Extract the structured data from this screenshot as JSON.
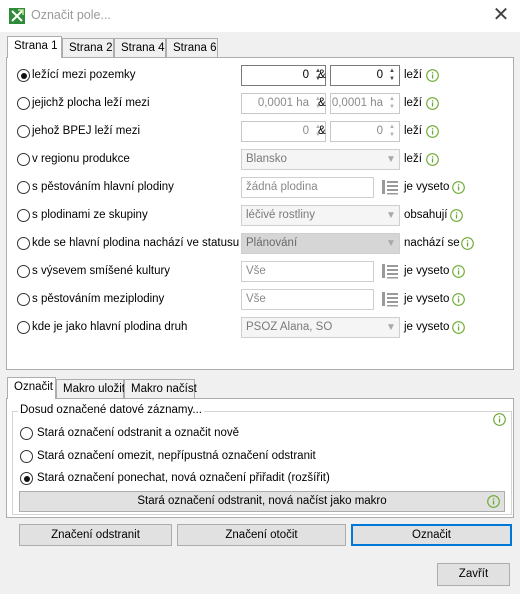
{
  "window": {
    "title": "Označit pole..."
  },
  "top_tabs": [
    {
      "label": "Strana 1",
      "active": true
    },
    {
      "label": "Strana 2",
      "active": false
    },
    {
      "label": "Strana 4",
      "active": false
    },
    {
      "label": "Strana 6",
      "active": false
    }
  ],
  "rows": {
    "r1": {
      "label": "ležící mezi pozemky",
      "from": "0",
      "amp": "&",
      "to": "0",
      "suffix": "leží",
      "selected": true
    },
    "r2": {
      "label": "jejichž plocha leží mezi",
      "from": "0,0001 ha",
      "amp": "&",
      "to": "0,0001 ha",
      "suffix": "leží"
    },
    "r3": {
      "label": "jehož BPEJ leží mezi",
      "from": "0",
      "amp": "&",
      "to": "0",
      "suffix": "leží"
    },
    "r4": {
      "label": "v regionu produkce",
      "value": "Blansko",
      "suffix": "leží"
    },
    "r5": {
      "label": "s pěstováním hlavní plodiny",
      "value": "žádná plodina",
      "suffix": "je vyseto"
    },
    "r6": {
      "label": "s plodinami ze skupiny",
      "value": "léčivé rostliny",
      "suffix": "obsahují"
    },
    "r7": {
      "label": "kde se hlavní plodina nachází ve statusu",
      "value": "Plánování",
      "suffix": "nachází se"
    },
    "r8": {
      "label": "s výsevem smíšené kultury",
      "value": "Vše",
      "suffix": "je vyseto"
    },
    "r9": {
      "label": "s pěstováním meziplodiny",
      "value": "Vše",
      "suffix": "je vyseto"
    },
    "r10": {
      "label": "kde je jako hlavní plodina druh",
      "value": "PSOZ  Alana, SO",
      "suffix": "je vyseto"
    }
  },
  "bottom_tabs": [
    {
      "label": "Označit",
      "active": true
    },
    {
      "label": "Makro uložit",
      "active": false
    },
    {
      "label": "Makro načíst",
      "active": false
    }
  ],
  "group": {
    "title": "Dosud označené datové záznamy...",
    "options": [
      {
        "label": "Stará označení odstranit a označit nově",
        "selected": false
      },
      {
        "label": "Stará označení omezit, nepřípustná označení odstranit",
        "selected": false
      },
      {
        "label": "Stará označení ponechat, nová označení přiřadit (rozšířit)",
        "selected": true
      }
    ],
    "macro_button": "Stará označení odstranit, nová načíst jako makro"
  },
  "actions": {
    "remove": "Značení odstranit",
    "invert": "Značení otočit",
    "mark": "Označit"
  },
  "close_label": "Zavřít",
  "colors": {
    "accent": "#0078d7",
    "info_icon": "#6aa82e",
    "app_icon": "#2e8b3a"
  }
}
